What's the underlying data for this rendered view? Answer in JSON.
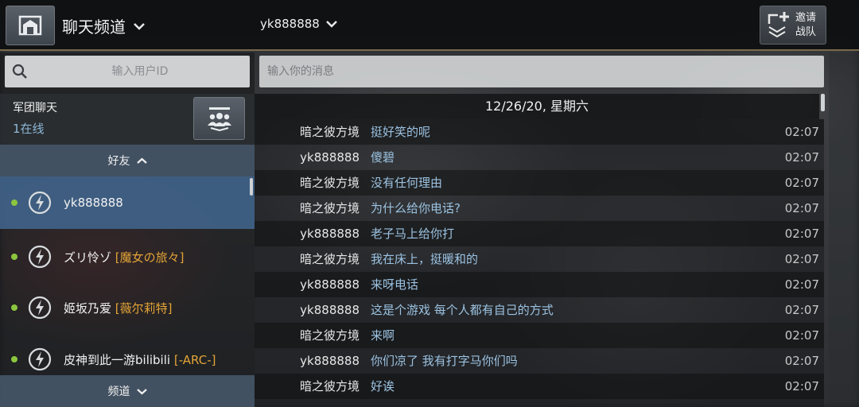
{
  "header": {
    "channel_title": "聊天频道",
    "selected_user": "yk888888",
    "invite_line1": "邀请",
    "invite_line2": "战队"
  },
  "sidebar": {
    "search_placeholder": "输入用户ID",
    "legion_title": "军团聊天",
    "legion_online": "1在线",
    "friends_header": "好友",
    "channels_header": "频道",
    "friends": [
      {
        "name": "yk888888",
        "clan": "",
        "status": "online"
      },
      {
        "name": "ズリ怜ゾ",
        "clan": "[魔女の旅々]",
        "status": "online"
      },
      {
        "name": "姬坂乃爱",
        "clan": "[薇尔莉特]",
        "status": "online"
      },
      {
        "name": "皮神到此一游bilibili",
        "clan": "[-ARC-]",
        "status": "online"
      }
    ]
  },
  "chat": {
    "input_placeholder": "输入你的消息",
    "date": "12/26/20, 星期六",
    "messages": [
      {
        "sender": "暗之彼方境",
        "text": "挺好笑的呢",
        "time": "02:07"
      },
      {
        "sender": "yk888888",
        "text": "傻碧",
        "time": "02:07"
      },
      {
        "sender": "暗之彼方境",
        "text": "没有任何理由",
        "time": "02:07"
      },
      {
        "sender": "暗之彼方境",
        "text": "为什么给你电话?",
        "time": "02:07"
      },
      {
        "sender": "yk888888",
        "text": "老子马上给你打",
        "time": "02:07"
      },
      {
        "sender": "暗之彼方境",
        "text": "我在床上，挺暖和的",
        "time": "02:07"
      },
      {
        "sender": "yk888888",
        "text": "来呀电话",
        "time": "02:07"
      },
      {
        "sender": "yk888888",
        "text": "这是个游戏 每个人都有自己的方式",
        "time": "02:07"
      },
      {
        "sender": "暗之彼方境",
        "text": "来啊",
        "time": "02:07"
      },
      {
        "sender": "yk888888",
        "text": "你们凉了 我有打字马你们吗",
        "time": "02:07"
      },
      {
        "sender": "暗之彼方境",
        "text": "好诶",
        "time": "02:07"
      }
    ]
  },
  "colors": {
    "accent_gold": "#7a6a4c",
    "clan_tag": "#e3a437",
    "message_text": "#9cc3e2",
    "online_dot": "#8cc63e",
    "selected_row": "#406288"
  },
  "icons": {
    "home": "home-icon",
    "dropdown": "chevron-down-icon",
    "invite": "invite-squad-icon",
    "search": "search-icon",
    "legion": "legion-group-icon",
    "player": "lightning-bolt-icon"
  }
}
